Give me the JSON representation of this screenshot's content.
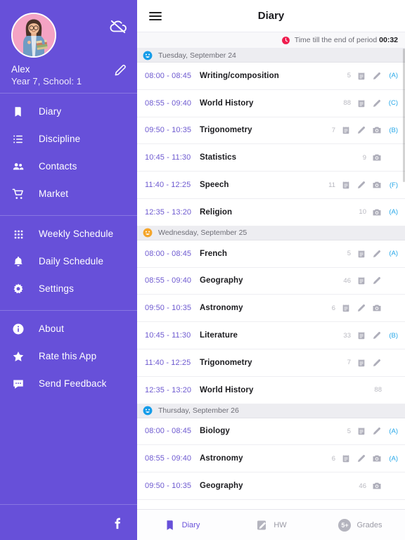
{
  "sidebar": {
    "profile": {
      "name": "Alex",
      "subtitle": "Year 7, School: 1",
      "avatar_icon": "user-photo-avatar",
      "sync_icon": "cloud-off-icon",
      "edit_icon": "pencil-icon"
    },
    "menu_groups": [
      {
        "items": [
          {
            "label": "Diary",
            "icon": "book-icon"
          },
          {
            "label": "Discipline",
            "icon": "list-icon"
          },
          {
            "label": "Contacts",
            "icon": "people-icon"
          },
          {
            "label": "Market",
            "icon": "cart-icon"
          }
        ]
      },
      {
        "items": [
          {
            "label": "Weekly Schedule",
            "icon": "grid-icon"
          },
          {
            "label": "Daily Schedule",
            "icon": "bell-icon"
          },
          {
            "label": "Settings",
            "icon": "gear-icon"
          }
        ]
      },
      {
        "items": [
          {
            "label": "About",
            "icon": "info-icon"
          },
          {
            "label": "Rate this App",
            "icon": "star-icon"
          },
          {
            "label": "Send Feedback",
            "icon": "chat-icon"
          }
        ]
      }
    ],
    "footer": {
      "icon": "facebook-icon"
    }
  },
  "appbar": {
    "menu_icon": "hamburger-icon",
    "title": "Diary"
  },
  "timer": {
    "icon": "clock-icon",
    "text": "Time till the end of period",
    "value": "00:32"
  },
  "colors": {
    "sidebar_purple": "#6750D9",
    "time_purple": "#6E5AD0",
    "grade_blue": "#26A7E8",
    "clock_red": "#EF1C4E",
    "day_emoji_blue": "#159CE9",
    "day_emoji_orange": "#F4A52A"
  },
  "days": [
    {
      "label": "Tuesday, September 24",
      "emoji": "smiley-blue-icon",
      "emoji_color": "#159CE9",
      "rows": [
        {
          "time": "08:00 - 08:45",
          "subject": "Writing/composition",
          "count": "5",
          "icons": [
            "note-icon",
            "pencil-icon"
          ],
          "grade": "(A)"
        },
        {
          "time": "08:55 - 09:40",
          "subject": "World History",
          "count": "88",
          "icons": [
            "note-icon",
            "pencil-icon"
          ],
          "grade": "(C)"
        },
        {
          "time": "09:50 - 10:35",
          "subject": "Trigonometry",
          "count": "7",
          "icons": [
            "note-icon",
            "pencil-icon",
            "camera-icon"
          ],
          "grade": "(B)"
        },
        {
          "time": "10:45 - 11:30",
          "subject": "Statistics",
          "count": "9",
          "icons": [
            "camera-icon"
          ],
          "grade": ""
        },
        {
          "time": "11:40 - 12:25",
          "subject": "Speech",
          "count": "11",
          "icons": [
            "note-icon",
            "pencil-icon",
            "camera-icon"
          ],
          "grade": "(F)"
        },
        {
          "time": "12:35 - 13:20",
          "subject": "Religion",
          "count": "10",
          "icons": [
            "camera-icon"
          ],
          "grade": "(A)"
        }
      ]
    },
    {
      "label": "Wednesday, September 25",
      "emoji": "smiley-orange-icon",
      "emoji_color": "#F4A52A",
      "rows": [
        {
          "time": "08:00 - 08:45",
          "subject": "French",
          "count": "5",
          "icons": [
            "note-icon",
            "pencil-icon"
          ],
          "grade": "(A)"
        },
        {
          "time": "08:55 - 09:40",
          "subject": "Geography",
          "count": "46",
          "icons": [
            "note-icon",
            "pencil-icon"
          ],
          "grade": ""
        },
        {
          "time": "09:50 - 10:35",
          "subject": "Astronomy",
          "count": "6",
          "icons": [
            "note-icon",
            "pencil-icon",
            "camera-icon"
          ],
          "grade": ""
        },
        {
          "time": "10:45 - 11:30",
          "subject": "Literature",
          "count": "33",
          "icons": [
            "note-icon",
            "pencil-icon"
          ],
          "grade": "(B)"
        },
        {
          "time": "11:40 - 12:25",
          "subject": "Trigonometry",
          "count": "7",
          "icons": [
            "note-icon",
            "pencil-icon"
          ],
          "grade": ""
        },
        {
          "time": "12:35 - 13:20",
          "subject": "World History",
          "count": "88",
          "icons": [],
          "grade": ""
        }
      ]
    },
    {
      "label": "Thursday, September 26",
      "emoji": "smiley-blue-icon",
      "emoji_color": "#159CE9",
      "rows": [
        {
          "time": "08:00 - 08:45",
          "subject": "Biology",
          "count": "5",
          "icons": [
            "note-icon",
            "pencil-icon"
          ],
          "grade": "(A)"
        },
        {
          "time": "08:55 - 09:40",
          "subject": "Astronomy",
          "count": "6",
          "icons": [
            "note-icon",
            "pencil-icon",
            "camera-icon"
          ],
          "grade": "(A)"
        },
        {
          "time": "09:50 - 10:35",
          "subject": "Geography",
          "count": "46",
          "icons": [
            "camera-icon"
          ],
          "grade": ""
        }
      ]
    }
  ],
  "bottom_tabs": [
    {
      "label": "Diary",
      "icon": "book-icon",
      "active": true,
      "badge": ""
    },
    {
      "label": "HW",
      "icon": "note-pencil-icon",
      "active": false,
      "badge": ""
    },
    {
      "label": "Grades",
      "icon": "badge-count-icon",
      "active": false,
      "badge": "5+"
    }
  ]
}
